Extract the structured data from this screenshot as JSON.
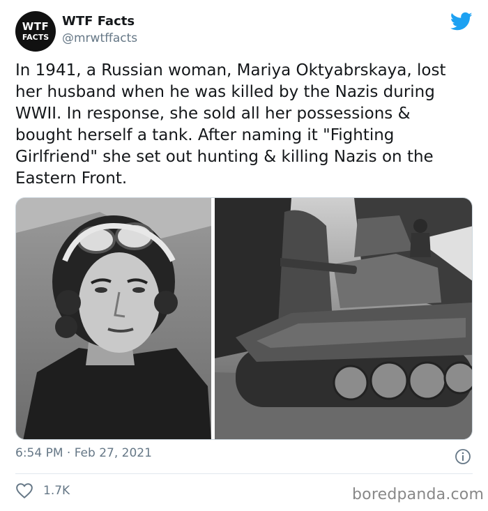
{
  "author": {
    "avatar_line1": "WTF",
    "avatar_line2": "FACTS",
    "display_name": "WTF Facts",
    "handle": "@mrwtffacts"
  },
  "tweet": {
    "text": "In 1941, a Russian woman, Mariya Oktyabrskaya, lost\nher husband when he was killed by the Nazis during\nWWII. In response, she sold all her possessions &\nbought herself a tank. After naming it \"Fighting\nGirlfriend\" she set out hunting & killing Nazis on the\nEastern Front.",
    "timestamp": "6:54 PM · Feb 27, 2021",
    "like_count": "1.7K"
  },
  "media": {
    "left_photo": "woman-aviator-portrait",
    "right_photo": "t34-tank-photo"
  },
  "watermark": "boredpanda.com",
  "colors": {
    "twitter_blue": "#1da1f2",
    "secondary_text": "#657786",
    "primary_text": "#14171a"
  }
}
